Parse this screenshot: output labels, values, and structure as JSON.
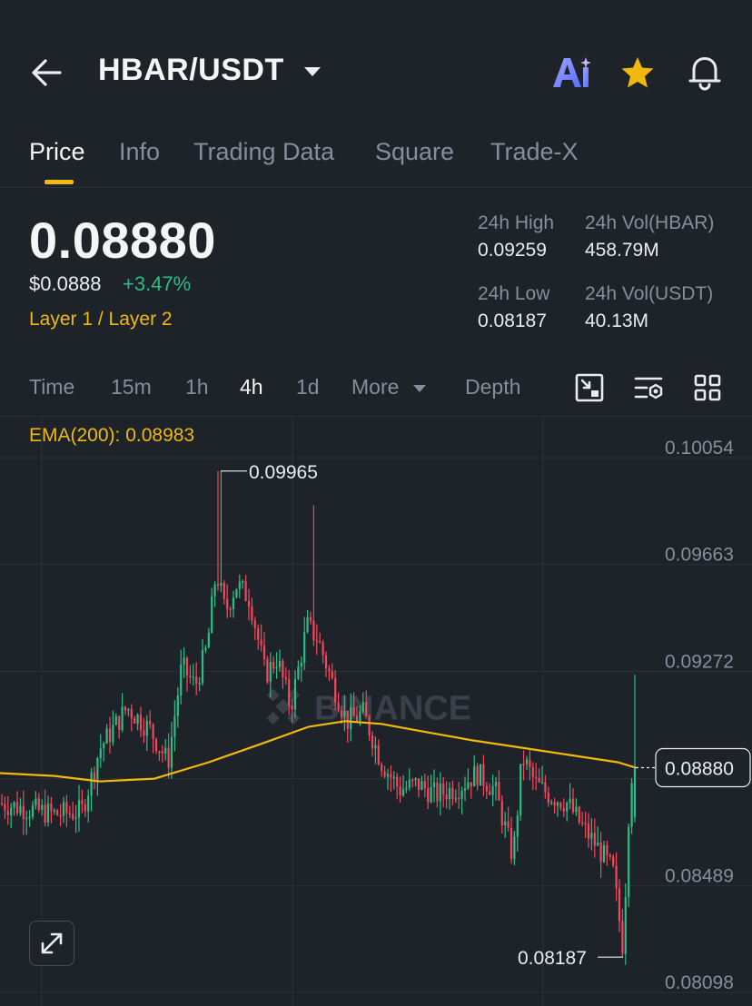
{
  "header": {
    "pair": "HBAR/USDT",
    "icons": [
      "back-arrow-icon",
      "dropdown-caret-icon",
      "ai-icon",
      "star-icon",
      "bell-icon"
    ],
    "accent_color": "#f0b90b"
  },
  "tabs": [
    "Price",
    "Info",
    "Trading Data",
    "Square",
    "Trade-X"
  ],
  "active_tab": "Price",
  "ticker": {
    "last_price": "0.08880",
    "usd_price": "$0.0888",
    "change_pct": "+3.47%",
    "category": "Layer 1 / Layer 2",
    "stats": {
      "high_label": "24h High",
      "high_value": "0.09259",
      "vol_base_label": "24h Vol(HBAR)",
      "vol_base_value": "458.79M",
      "low_label": "24h Low",
      "low_value": "0.08187",
      "vol_quote_label": "24h Vol(USDT)",
      "vol_quote_value": "40.13M"
    }
  },
  "timeframes": {
    "items": [
      "Time",
      "15m",
      "1h",
      "4h",
      "1d"
    ],
    "more": "More",
    "depth": "Depth",
    "active": "4h",
    "tool_icons": [
      "chart-settings-icon",
      "indicator-settings-icon",
      "layout-grid-icon"
    ]
  },
  "chart_data": {
    "type": "candlestick",
    "interval": "4h",
    "indicator": {
      "label": "EMA(200): 0.08983",
      "name": "EMA(200)",
      "value": 0.08983
    },
    "y_ticks": [
      "0.10054",
      "0.09663",
      "0.09272",
      "0.08880",
      "0.08489",
      "0.08098"
    ],
    "ylim": [
      0.08098,
      0.10054
    ],
    "current_price_label": "0.08880",
    "current_price": 0.0888,
    "max_label": "0.09965",
    "max": 0.09965,
    "min_label": "0.08187",
    "min": 0.08187,
    "watermark": "BINANCE",
    "up_color": "#2ebd85",
    "down_color": "#f6465d",
    "ema_color": "#f0b90b"
  }
}
